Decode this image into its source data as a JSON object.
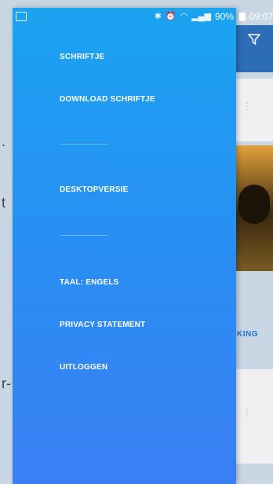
{
  "status_bar": {
    "battery": "90%",
    "time": "09:07"
  },
  "drawer": {
    "items": [
      {
        "label": "SCHRIFTJE"
      },
      {
        "label": "DOWNLOAD SCHRIFTJE"
      },
      {
        "label": "DESKTOPVERSIE"
      },
      {
        "label": "TAAL: ENGELS"
      },
      {
        "label": "PRIVACY STATEMENT"
      },
      {
        "label": "UITLOGGEN"
      }
    ]
  },
  "background_app": {
    "card_action_fragment": "KING",
    "left_fragments": [
      ".",
      "t",
      "r-"
    ]
  },
  "colors": {
    "drawer_top": "#1aa3f0",
    "drawer_bottom": "#3b7ff4",
    "app_bar": "#2d6db6",
    "link_blue": "#1e73c9"
  }
}
